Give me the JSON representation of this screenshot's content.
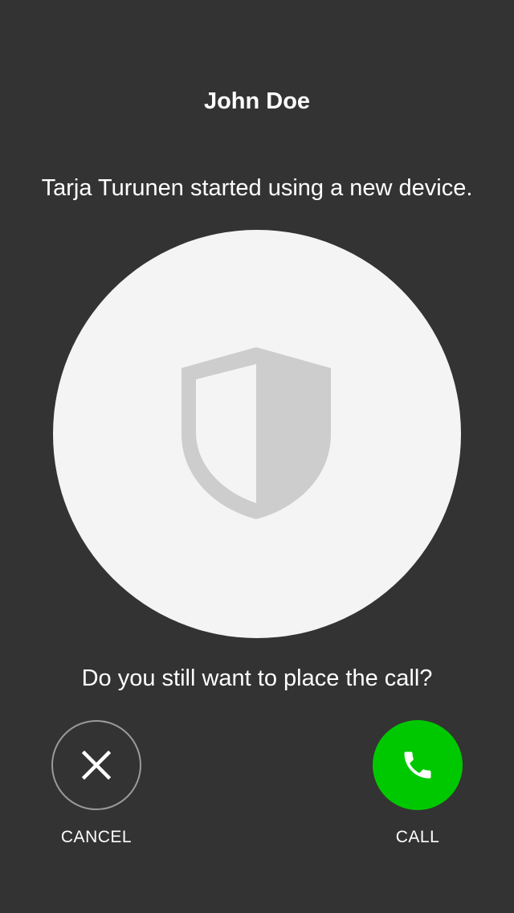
{
  "header": {
    "title": "John Doe"
  },
  "warning": {
    "message": "Tarja Turunen started using a new device.",
    "icon": "shield-icon"
  },
  "prompt": {
    "question": "Do you still want to place the call?"
  },
  "actions": {
    "cancel_label": "CANCEL",
    "cancel_icon": "close-icon",
    "call_label": "CALL",
    "call_icon": "phone-icon"
  },
  "colors": {
    "background": "#333333",
    "circle": "#f4f4f4",
    "shield": "#cdcdcd",
    "call_accent": "#00c800",
    "cancel_border": "#9a9a9a",
    "text": "#ffffff"
  }
}
